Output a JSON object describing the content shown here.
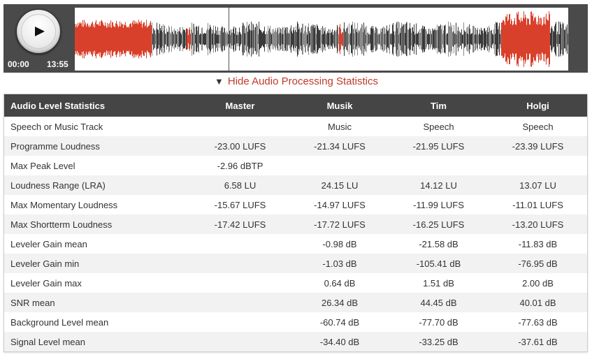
{
  "player": {
    "current_time": "00:00",
    "total_time": "13:55",
    "accent_color": "#d9402b"
  },
  "toggle": {
    "arrow": "▼",
    "label": "Hide Audio Processing Statistics"
  },
  "stats": {
    "headers": [
      "Audio Level Statistics",
      "Master",
      "Musik",
      "Tim",
      "Holgi"
    ],
    "rows": [
      [
        "Speech or Music Track",
        "",
        "Music",
        "Speech",
        "Speech"
      ],
      [
        "Programme Loudness",
        "-23.00 LUFS",
        "-21.34 LUFS",
        "-21.95 LUFS",
        "-23.39 LUFS"
      ],
      [
        "Max Peak Level",
        "-2.96 dBTP",
        "",
        "",
        ""
      ],
      [
        "Loudness Range (LRA)",
        "6.58 LU",
        "24.15 LU",
        "14.12 LU",
        "13.07 LU"
      ],
      [
        "Max Momentary Loudness",
        "-15.67 LUFS",
        "-14.97 LUFS",
        "-11.99 LUFS",
        "-11.01 LUFS"
      ],
      [
        "Max Shortterm Loudness",
        "-17.42 LUFS",
        "-17.72 LUFS",
        "-16.25 LUFS",
        "-13.20 LUFS"
      ],
      [
        "Leveler Gain mean",
        "",
        "-0.98 dB",
        "-21.58 dB",
        "-11.83 dB"
      ],
      [
        "Leveler Gain min",
        "",
        "-1.03 dB",
        "-105.41 dB",
        "-76.95 dB"
      ],
      [
        "Leveler Gain max",
        "",
        "0.64 dB",
        "1.51 dB",
        "2.00 dB"
      ],
      [
        "SNR mean",
        "",
        "26.34 dB",
        "44.45 dB",
        "40.01 dB"
      ],
      [
        "Background Level mean",
        "",
        "-60.74 dB",
        "-77.70 dB",
        "-77.63 dB"
      ],
      [
        "Signal Level mean",
        "",
        "-34.40 dB",
        "-33.25 dB",
        "-37.61 dB"
      ]
    ]
  }
}
